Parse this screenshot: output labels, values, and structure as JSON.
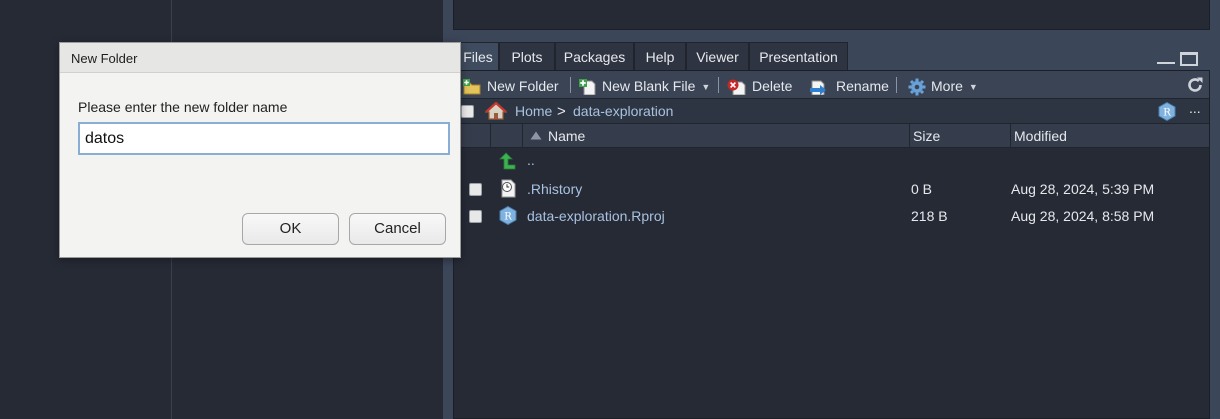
{
  "dialog": {
    "title": "New Folder",
    "prompt": "Please enter the new folder name",
    "input_value": "datos",
    "ok_label": "OK",
    "cancel_label": "Cancel"
  },
  "files_pane": {
    "tabs": [
      {
        "label": "Files",
        "active": true
      },
      {
        "label": "Plots",
        "active": false
      },
      {
        "label": "Packages",
        "active": false
      },
      {
        "label": "Help",
        "active": false
      },
      {
        "label": "Viewer",
        "active": false
      },
      {
        "label": "Presentation",
        "active": false
      }
    ],
    "toolbar": {
      "new_folder": "New Folder",
      "new_blank_file": "New Blank File",
      "delete": "Delete",
      "rename": "Rename",
      "more": "More"
    },
    "path": {
      "home": "Home",
      "separator": ">",
      "folder": "data-exploration",
      "ellipsis": "..."
    },
    "columns": {
      "name": "Name",
      "size": "Size",
      "modified": "Modified"
    },
    "rows": [
      {
        "name": "..",
        "size": "",
        "modified": "",
        "icon": "up-arrow-icon"
      },
      {
        "name": ".Rhistory",
        "size": "0 B",
        "modified": "Aug 28, 2024, 5:39 PM",
        "icon": "history-file-icon"
      },
      {
        "name": "data-exploration.Rproj",
        "size": "218 B",
        "modified": "Aug 28, 2024, 8:58 PM",
        "icon": "rproj-icon"
      }
    ]
  },
  "colors": {
    "background": "#262a35",
    "pane_frame": "#3b4658",
    "link": "#a8c2e0",
    "dialog_bg": "#f3f3f1",
    "input_focus_border": "#8aaed3"
  }
}
